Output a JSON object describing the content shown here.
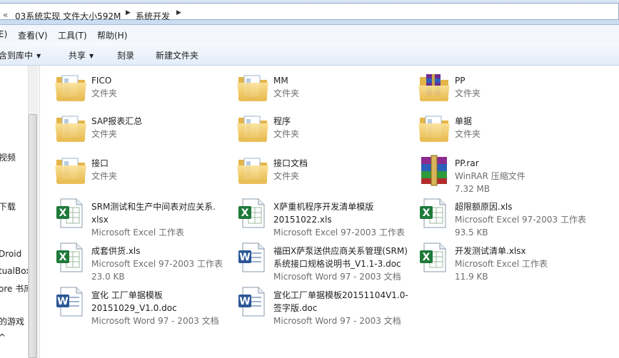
{
  "address": {
    "crumbs": [
      "«",
      "03系统实现 文件大小592M",
      "系统开发"
    ]
  },
  "menu": [
    "E)",
    "查看(V)",
    "工具(T)",
    "帮助(H)"
  ],
  "toolbar": {
    "include_library": "包含到库中",
    "share": "共享",
    "burn": "刻录",
    "new_folder": "新建文件夹"
  },
  "nav": [
    "视频",
    "下载",
    "Droid",
    "tualBox",
    "ore 书库",
    "的游戏",
    "^"
  ],
  "items": [
    {
      "name": "FICO",
      "line2": "文件夹",
      "line3": "",
      "icon": "folder-icon"
    },
    {
      "name": "MM",
      "line2": "文件夹",
      "line3": "",
      "icon": "folder-icon"
    },
    {
      "name": "PP",
      "line2": "文件夹",
      "line3": "",
      "icon": "winrar-folder-icon"
    },
    {
      "name": "SAP报表汇总",
      "line2": "文件夹",
      "line3": "",
      "icon": "folder-icon"
    },
    {
      "name": "程序",
      "line2": "文件夹",
      "line3": "",
      "icon": "folder-icon"
    },
    {
      "name": "单据",
      "line2": "文件夹",
      "line3": "",
      "icon": "folder-icon"
    },
    {
      "name": "接口",
      "line2": "文件夹",
      "line3": "",
      "icon": "folder-icon"
    },
    {
      "name": "接口文档",
      "line2": "文件夹",
      "line3": "",
      "icon": "folder-icon"
    },
    {
      "name": "PP.rar",
      "line2": "WinRAR 压缩文件",
      "line3": "7.32 MB",
      "icon": "winrar-archive-icon"
    },
    {
      "name": "SRM测试和生产中间表对应关系.",
      "name2": "xlsx",
      "line2": "Microsoft Excel 工作表",
      "line3": "",
      "icon": "excel-file-icon"
    },
    {
      "name": "X萨重机程序开发清单模版",
      "name2": "20151022.xls",
      "line2": "Microsoft Excel 97-2003 工作表",
      "line3": "",
      "icon": "excel-file-icon"
    },
    {
      "name": "超限额原因.xls",
      "line2": "Microsoft Excel 97-2003 工作表",
      "line3": "93.5 KB",
      "icon": "excel-file-icon"
    },
    {
      "name": "成套供货.xls",
      "line2": "Microsoft Excel 97-2003 工作表",
      "line3": "23.0 KB",
      "icon": "excel-file-icon"
    },
    {
      "name": "福田X萨泵送供应商关系管理(SRM)",
      "name2": "系统接口规格说明书_V1.1-3.doc",
      "line2": "Microsoft Word 97 - 2003 文档",
      "line3": "",
      "icon": "word-file-icon"
    },
    {
      "name": "开发测试清单.xlsx",
      "line2": "Microsoft Excel 工作表",
      "line3": "11.9 KB",
      "icon": "excel-file-icon"
    },
    {
      "name": "宣化 工厂单据模板",
      "name2": "20151029_V1.0.doc",
      "line2": "Microsoft Word 97 - 2003 文档",
      "line3": "",
      "icon": "word-file-icon"
    },
    {
      "name": "宣化工厂单据模板20151104V1.0-",
      "name2": "签字版.doc",
      "line2": "Microsoft Word 97 - 2003 文档",
      "line3": "",
      "icon": "word-file-icon"
    }
  ],
  "colors": {
    "excel": "#1f7a3a",
    "word": "#2b5797",
    "folder": "#f2cf6b",
    "selection_bar": "#c9dcf1"
  }
}
